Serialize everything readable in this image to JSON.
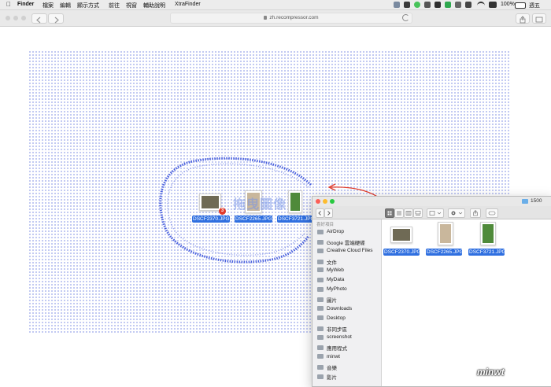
{
  "menubar": {
    "app": "Finder",
    "menus": [
      "檔案",
      "編輯",
      "顯示方式",
      "前往",
      "視窗",
      "輔助說明",
      "XtraFinder"
    ],
    "battery": "100%",
    "clock": "週五"
  },
  "browser": {
    "url": "zh.recompressor.com"
  },
  "drag": {
    "files": [
      {
        "name": "DSCF2370.JPG",
        "photo_color": "#6f6a55"
      },
      {
        "name": "DSCF2265.JPG",
        "photo_color": "#c9b79c"
      },
      {
        "name": "DSCF3721.JPG",
        "photo_color": "#4f8a3a"
      }
    ],
    "count_badge": "3",
    "watermark": "拖曳圖像"
  },
  "finder": {
    "title": "1500",
    "sidebar_header": "喜好項目",
    "sidebar": [
      {
        "label": "AirDrop",
        "icon": "airdrop-icon"
      },
      {
        "label": "Google 雲端硬碟",
        "icon": "folder-icon"
      },
      {
        "label": "Creative Cloud Files",
        "icon": "folder-icon"
      },
      {
        "label": "文件",
        "icon": "documents-icon"
      },
      {
        "label": "MyWeb",
        "icon": "folder-icon"
      },
      {
        "label": "MyData",
        "icon": "folder-icon"
      },
      {
        "label": "MyPhoto",
        "icon": "folder-icon"
      },
      {
        "label": "圖片",
        "icon": "pictures-icon"
      },
      {
        "label": "Downloads",
        "icon": "downloads-icon"
      },
      {
        "label": "Desktop",
        "icon": "folder-icon"
      },
      {
        "label": "非同步區",
        "icon": "folder-icon"
      },
      {
        "label": "screenshot",
        "icon": "folder-icon"
      },
      {
        "label": "應用程式",
        "icon": "applications-icon"
      },
      {
        "label": "minwt",
        "icon": "home-icon"
      },
      {
        "label": "音樂",
        "icon": "music-icon"
      },
      {
        "label": "影片",
        "icon": "movies-icon"
      }
    ],
    "files": [
      {
        "name": "DSCF2370.JPG",
        "photo_color": "#6f6a55"
      },
      {
        "name": "DSCF2265.JPG",
        "photo_color": "#c9b79c"
      },
      {
        "name": "DSCF3721.JPG",
        "photo_color": "#4f8a3a"
      }
    ]
  },
  "watermark_site": "minwt",
  "colors": {
    "selection": "#2f6fe0",
    "dots": "#9aa6ea",
    "arrow": "#e23b2a"
  }
}
